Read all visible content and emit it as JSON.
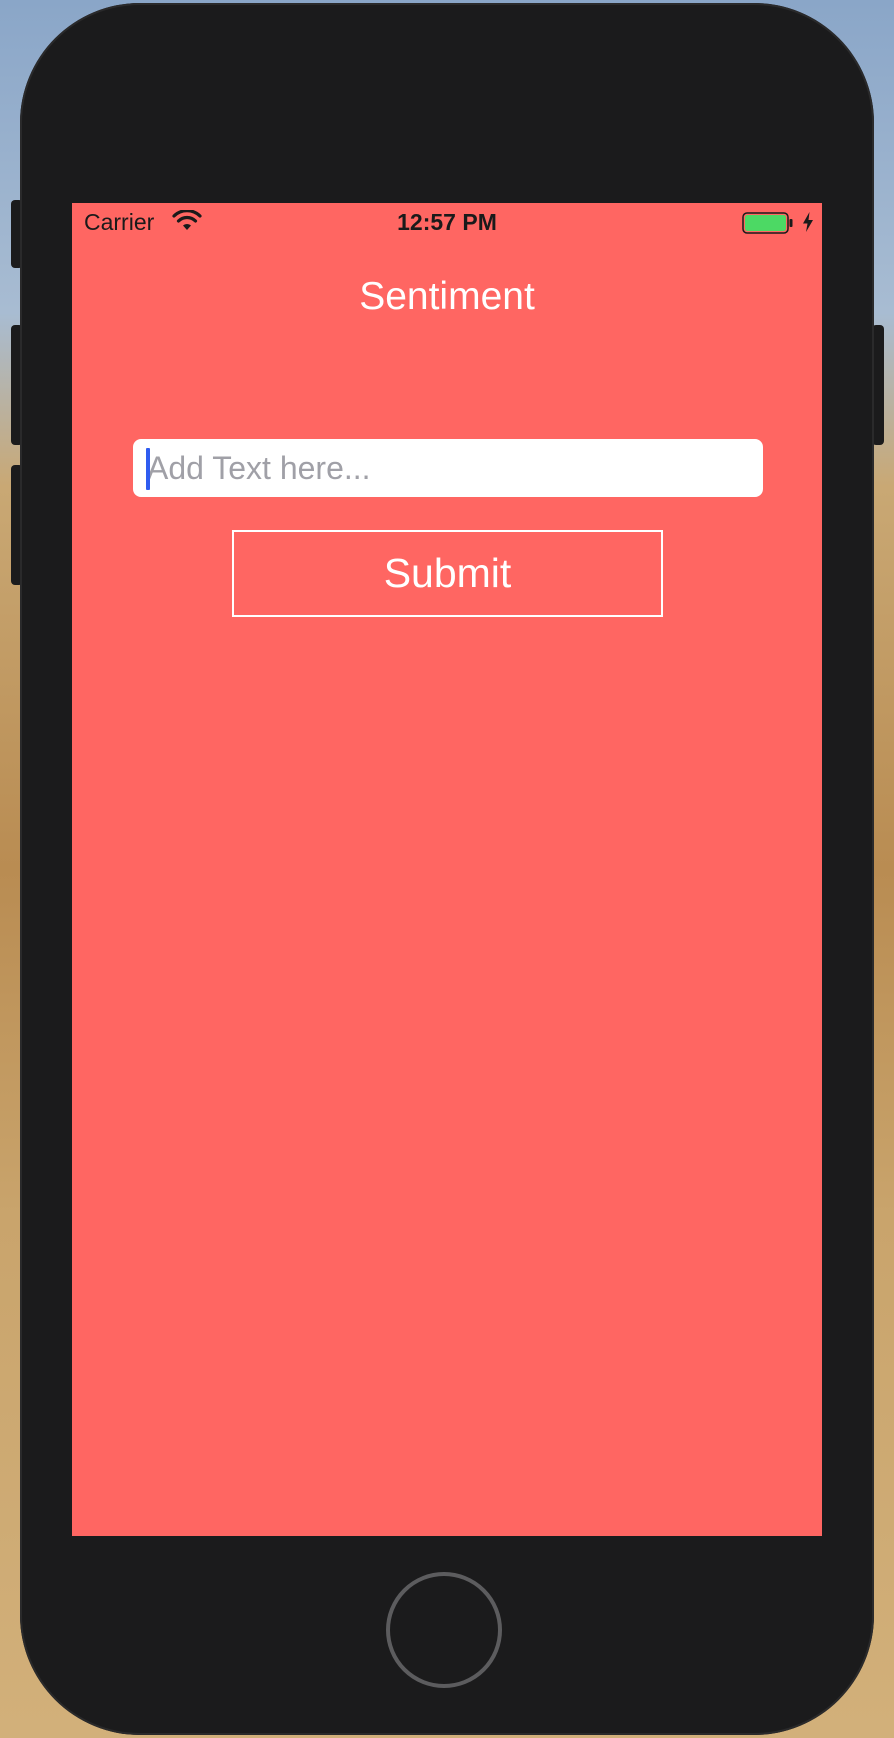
{
  "status_bar": {
    "carrier": "Carrier",
    "time": "12:57 PM",
    "wifi_icon": "wifi-icon",
    "battery_icon": "battery-icon",
    "charging_icon": "lightning-bolt-icon"
  },
  "app": {
    "title": "Sentiment",
    "input": {
      "value": "",
      "placeholder": "Add Text here..."
    },
    "submit_label": "Submit"
  },
  "colors": {
    "background": "#ff6662",
    "text": "#ffffff",
    "placeholder": "#a0a0a7",
    "caret": "#2f5cf0",
    "battery_fill": "#4cd964"
  }
}
